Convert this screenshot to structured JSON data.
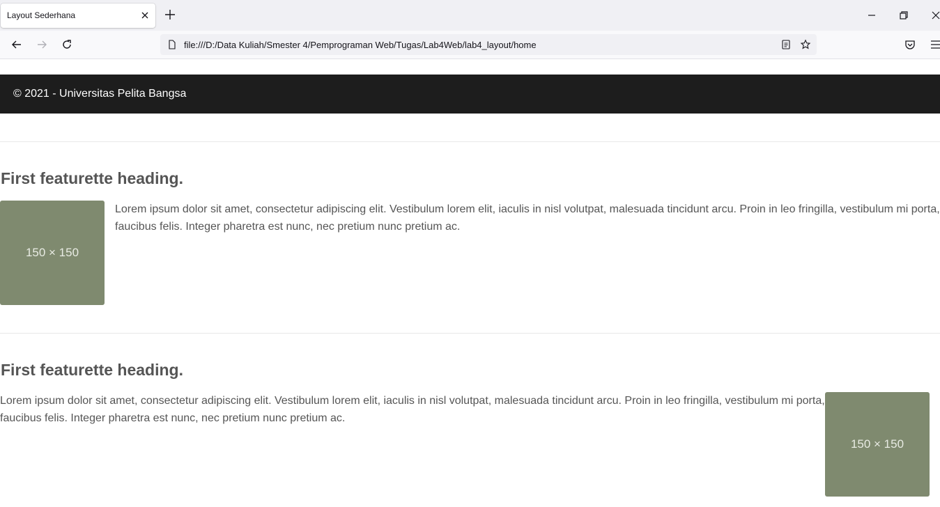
{
  "browser": {
    "tab_title": "Layout Sederhana",
    "url": "file:///D:/Data Kuliah/Smester 4/Pemprograman Web/Tugas/Lab4Web/lab4_layout/home"
  },
  "footer": {
    "text": "© 2021 - Universitas Pelita Bangsa"
  },
  "featurettes": [
    {
      "heading": "First featurette heading.",
      "body": "Lorem ipsum dolor sit amet, consectetur adipiscing elit. Vestibulum lorem elit, iaculis in nisl volutpat, malesuada tincidunt arcu. Proin in leo fringilla, vestibulum mi porta, faucibus felis. Integer pharetra est nunc, nec pretium nunc pretium ac.",
      "image_label": "150 × 150",
      "image_side": "left"
    },
    {
      "heading": "First featurette heading.",
      "body": "Lorem ipsum dolor sit amet, consectetur adipiscing elit. Vestibulum lorem elit, iaculis in nisl volutpat, malesuada tincidunt arcu. Proin in leo fringilla, vestibulum mi porta, faucibus felis. Integer pharetra est nunc, nec pretium nunc pretium ac.",
      "image_label": "150 × 150",
      "image_side": "right"
    }
  ],
  "colors": {
    "footer_bg": "#1d1d1d",
    "placeholder_bg": "#7f8a6f",
    "text": "#555555"
  }
}
